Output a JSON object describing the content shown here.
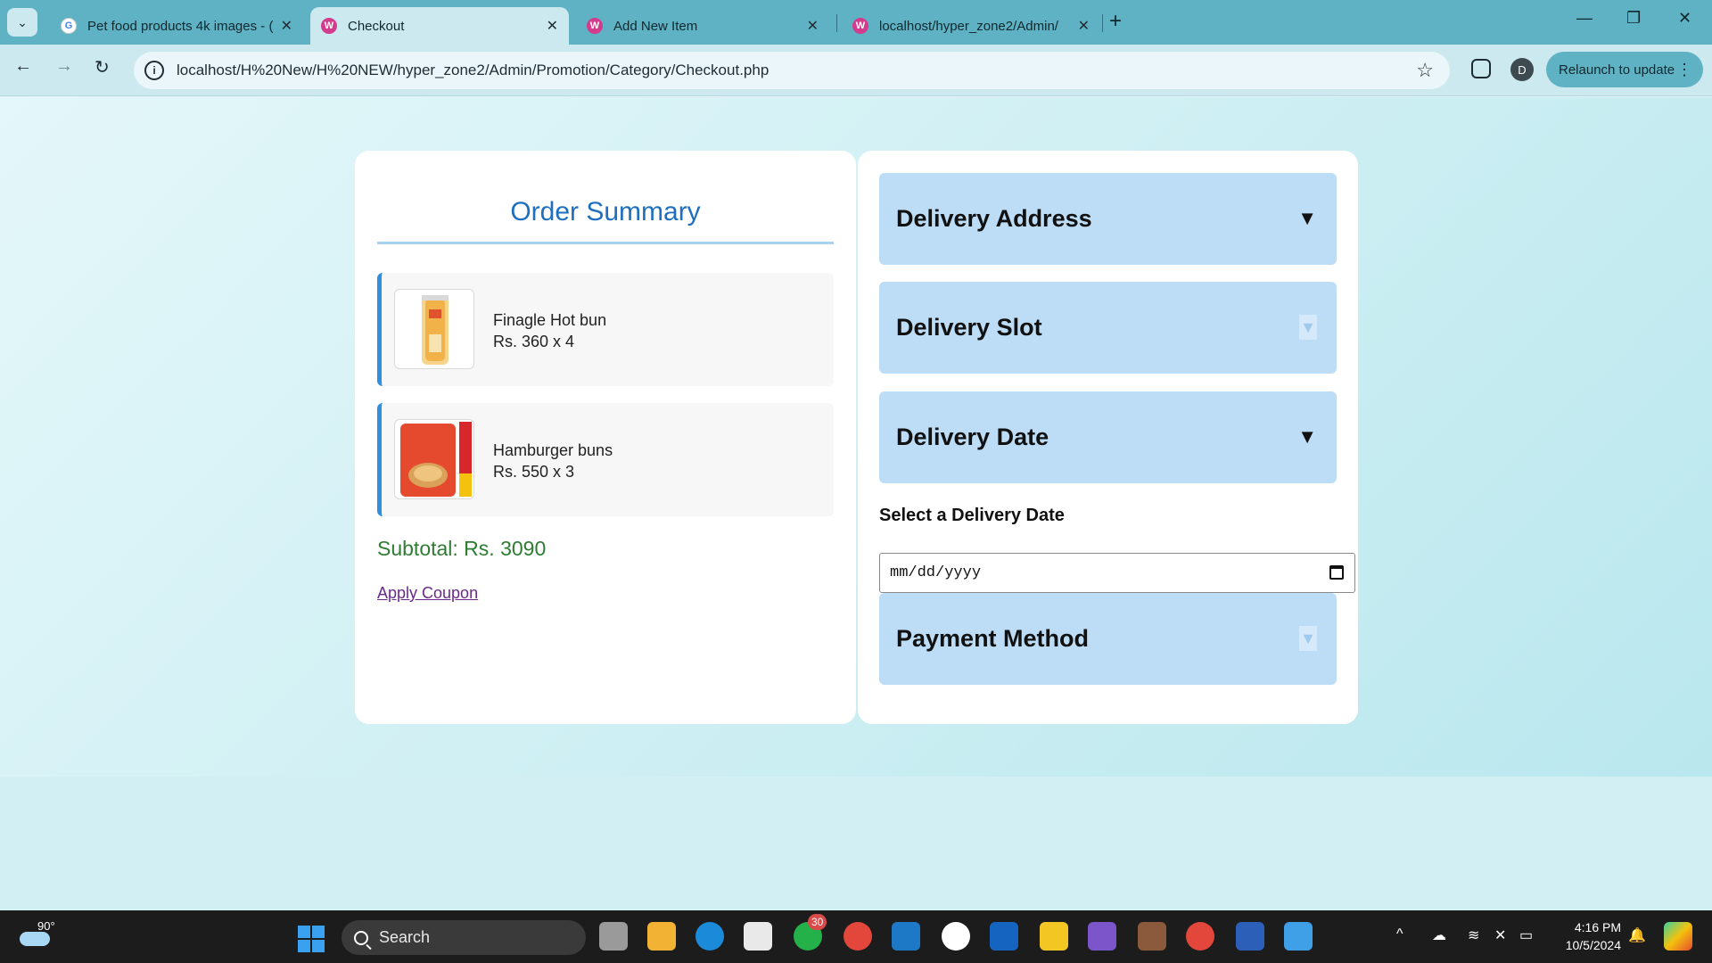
{
  "browser": {
    "tabs": [
      {
        "title": "Pet food products 4k images - (",
        "favicon": "google-icon"
      },
      {
        "title": "Checkout",
        "favicon": "webapp-icon"
      },
      {
        "title": "Add New Item",
        "favicon": "webapp-icon"
      },
      {
        "title": "localhost/hyper_zone2/Admin/",
        "favicon": "webapp-icon"
      }
    ],
    "url": "localhost/H%20New/H%20NEW/hyper_zone2/Admin/Promotion/Category/Checkout.php",
    "profile_initial": "D",
    "relaunch_label": "Relaunch to update"
  },
  "order_summary": {
    "title": "Order Summary",
    "items": [
      {
        "name": "Finagle Hot bun",
        "price": "Rs. 360 x 4"
      },
      {
        "name": "Hamburger buns",
        "price": "Rs. 550 x 3"
      }
    ],
    "subtotal": "Subtotal: Rs. 3090",
    "coupon_link": "Apply Coupon"
  },
  "checkout": {
    "sections": [
      {
        "label": "Delivery Address",
        "arrow": "▼"
      },
      {
        "label": "Delivery Slot",
        "arrow": "▼"
      },
      {
        "label": "Delivery Date",
        "arrow": "▼"
      },
      {
        "label": "Payment Method",
        "arrow": "▼"
      }
    ],
    "date_label": "Select a Delivery Date",
    "date_placeholder": "mm/dd/yyyy"
  },
  "taskbar": {
    "temperature": "90°",
    "search_label": "Search",
    "whatsapp_badge": "30",
    "time": "4:16 PM",
    "date": "10/5/2024"
  },
  "colors": {
    "accent": "#1e6fc0",
    "accordion": "#bddcf6",
    "subtotal": "#2e7d32",
    "item_border": "#2f8fe0"
  }
}
